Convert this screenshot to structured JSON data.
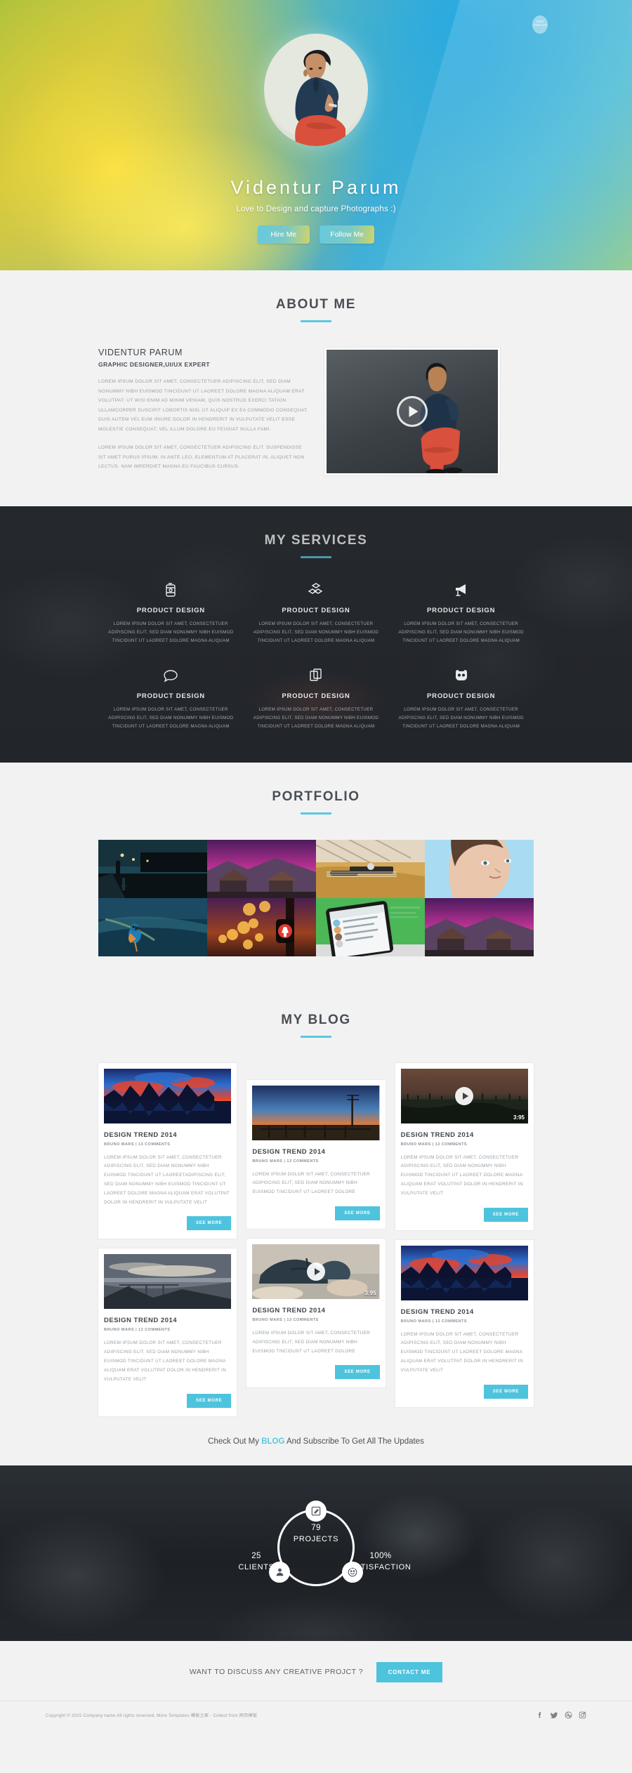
{
  "hero": {
    "badge_text": "FREE TEMPLATE",
    "title": "Videntur Parum",
    "subtitle": "Love to Design and capture Photographs :)",
    "hire_button": "Hire Me",
    "follow_button": "Follow Me",
    "accent": "#5bc8e0"
  },
  "about": {
    "heading": "ABOUT ME",
    "name": "VIDENTUR PARUM",
    "role": "GRAPHIC DESIGNER,UI/UX EXPERT",
    "paragraph1": "LOREM IPSUM DOLOR SIT AMET, CONSECTETUER ADIPISCING ELIT, SED DIAM NONUMMY NIBH EUISMOD TINCIDUNT UT LAOREET DOLORE MAGNA ALIQUAM ERAT VOLUTPAT. UT WISI ENIM AD MINIM VENIAM, QUIS NOSTRUD EXERCI TATION ULLAMCORPER SUSCIPIT LOBORTIS NISL UT ALIQUIP EX EA COMMODO CONSEQUAT. DUIS AUTEM VEL EUM IRIURE DOLOR IN HENDRERIT IN VULPUTATE VELIT ESSE MOLESTIE CONSEQUAT, VEL ILLUM DOLORE EU FEUGIAT NULLA FAMI.",
    "paragraph2": "LOREM IPSUM DOLOR SIT AMET, CONSECTETUER ADIPISCING ELIT. SUSPENDISSE SIT AMET PURUS IPSUM. IN ANTE LEO, ELEMENTUM AT PLACERAT IN, ALIQUET NON LECTUS. NAM IMPERDIET MAGNA EU FAUCIBUS CURSUS."
  },
  "services": {
    "heading": "MY SERVICES",
    "items": [
      {
        "icon": "coffee-cup-icon",
        "title": "PRODUCT DESIGN",
        "text": "LOREM IPSUM DOLOR SIT AMET, CONSECTETUER ADIPISCING ELIT, SED DIAM NONUMMY NIBH EUISMOD TINCIDUNT UT LAOREET DOLORE MAGNA ALIQUAM"
      },
      {
        "icon": "blocks-icon",
        "title": "PRODUCT DESIGN",
        "text": "LOREM IPSUM DOLOR SIT AMET, CONSECTETUER ADIPISCING ELIT, SED DIAM NONUMMY NIBH EUISMOD TINCIDUNT UT LAOREET DOLORE MAGNA ALIQUAM"
      },
      {
        "icon": "megaphone-icon",
        "title": "PRODUCT DESIGN",
        "text": "LOREM IPSUM DOLOR SIT AMET, CONSECTETUER ADIPISCING ELIT, SED DIAM NONUMMY NIBH EUISMOD TINCIDUNT UT LAOREET DOLORE MAGNA ALIQUAM"
      },
      {
        "icon": "speech-bubble-icon",
        "title": "PRODUCT DESIGN",
        "text": "LOREM IPSUM DOLOR SIT AMET, CONSECTETUER ADIPISCING ELIT, SED DIAM NONUMMY NIBH EUISMOD TINCIDUNT UT LAOREET DOLORE MAGNA ALIQUAM"
      },
      {
        "icon": "copy-pages-icon",
        "title": "PRODUCT DESIGN",
        "text": "LOREM IPSUM DOLOR SIT AMET, CONSECTETUER ADIPISCING ELIT, SED DIAM NONUMMY NIBH EUISMOD TINCIDUNT UT LAOREET DOLORE MAGNA ALIQUAM"
      },
      {
        "icon": "octocat-icon",
        "title": "PRODUCT DESIGN",
        "text": "LOREM IPSUM DOLOR SIT AMET, CONSECTETUER ADIPISCING ELIT, SED DIAM NONUMMY NIBH EUISMOD TINCIDUNT UT LAOREET DOLORE MAGNA ALIQUAM"
      }
    ]
  },
  "portfolio": {
    "heading": "PORTFOLIO",
    "items": [
      {
        "name": "night-pier-photo"
      },
      {
        "name": "purple-sunset-barn-photo"
      },
      {
        "name": "guitar-closeup-photo"
      },
      {
        "name": "woman-portrait-photo"
      },
      {
        "name": "kingfisher-bird-photo"
      },
      {
        "name": "city-bokeh-lights-photo"
      },
      {
        "name": "smartphone-app-photo"
      },
      {
        "name": "purple-sunset-barn-photo-2"
      }
    ]
  },
  "blog": {
    "heading": "MY BLOG",
    "posts": [
      {
        "thumb": "colorful-city-reflection-photo",
        "title": "DESIGN TREND 2014",
        "meta": "BRUNO MARS | 13 COMMENTS",
        "excerpt": "LOREM IPSUM DOLOR SIT AMET, CONSECTETUER ADIPISCING ELIT, SED DIAM NONUMMY NIBH EUISMOD TINCIDUNT UT LAOREETADIPISCING ELIT, SED DIAM NONUMMY NIBH EUISMOD TINCIDUNT UT LAOREET DOLORE MAGNA ALIQUAM ERAT VOLUTPAT DOLOR IN HENDRERIT IN VULPUTATE VELIT",
        "button": "SEE MORE",
        "has_video": false,
        "duration": ""
      },
      {
        "thumb": "misty-bridge-photo",
        "title": "DESIGN TREND 2014",
        "meta": "BRUNO MARS | 13 COMMENTS",
        "excerpt": "LOREM IPSUM DOLOR SIT AMET, CONSECTETUER ADIPISCING ELIT, SED DIAM NONUMMY NIBH EUISMOD TINCIDUNT UT LAOREET DOLORE MAGNA ALIQUAM ERAT VOLUTPAT DOLOR IN HENDRERIT IN VULPUTATE VELIT",
        "button": "SEE MORE",
        "has_video": false,
        "duration": ""
      },
      {
        "thumb": "dusk-pier-photo",
        "title": "DESIGN TREND 2014",
        "meta": "BRUNO MARS | 13 COMMENTS",
        "excerpt": "LOREM IPSUM DOLOR SIT AMET, CONSECTETUER ADIPISCING ELIT, SED DIAM NONUMMY NIBH EUISMOD TINCIDUNT UT LAOREET DOLORE",
        "button": "SEE MORE",
        "has_video": false,
        "duration": ""
      },
      {
        "thumb": "umbrella-video-thumb",
        "title": "DESIGN TREND 2014",
        "meta": "BRUNO MARS | 13 COMMENTS",
        "excerpt": "LOREM IPSUM DOLOR SIT AMET, CONSECTETUER ADIPISCING ELIT, SED DIAM NONUMMY NIBH EUISMOD TINCIDUNT UT LAOREET DOLORE",
        "button": "SEE MORE",
        "has_video": true,
        "duration": "3:95"
      },
      {
        "thumb": "dark-field-video-thumb",
        "title": "DESIGN TREND 2014",
        "meta": "BRUNO MARS | 13 COMMENTS",
        "excerpt": "LOREM IPSUM DOLOR SIT AMET, CONSECTETUER ADIPISCING ELIT, SED DIAM NONUMMY NIBH EUISMOD TINCIDUNT UT LAOREET DOLORE MAGNA ALIQUAM ERAT VOLUTPAT DOLOR IN HENDRERIT IN VULPUTATE VELIT",
        "button": "SEE MORE",
        "has_video": true,
        "duration": "3:95"
      },
      {
        "thumb": "colorful-city-reflection-photo-2",
        "title": "DESIGN TREND 2014",
        "meta": "BRUNO MARS | 13 COMMENTS",
        "excerpt": "LOREM IPSUM DOLOR SIT AMET, CONSECTETUER ADIPISCING ELIT, SED DIAM NONUMMY NIBH EUISMOD TINCIDUNT UT LAOREET DOLORE MAGNA ALIQUAM ERAT VOLUTPAT DOLOR IN HENDRERIT IN VULPUTATE VELIT",
        "button": "SEE MORE",
        "has_video": false,
        "duration": ""
      }
    ]
  },
  "subscribe": {
    "prefix": "Check Out My ",
    "link": "BLOG",
    "suffix": " And Subscribe To Get All The Updates"
  },
  "stats": {
    "projects_number": "79",
    "projects_label": "PROJECTS",
    "clients_number": "25",
    "clients_label": "CLIENTS",
    "satisfaction_number": "100%",
    "satisfaction_label": "SATISFACTION"
  },
  "contact": {
    "question": "WANT TO DISCUSS ANY CREATIVE PROJCT ?",
    "button": "CONTACT ME"
  },
  "footer": {
    "copyright": "Copyright © 2015 Company name All rights reserved. More Templates 模板之家 - Collect from 网页模板",
    "social": [
      "facebook-icon",
      "twitter-icon",
      "dribbble-icon",
      "instagram-icon"
    ]
  }
}
